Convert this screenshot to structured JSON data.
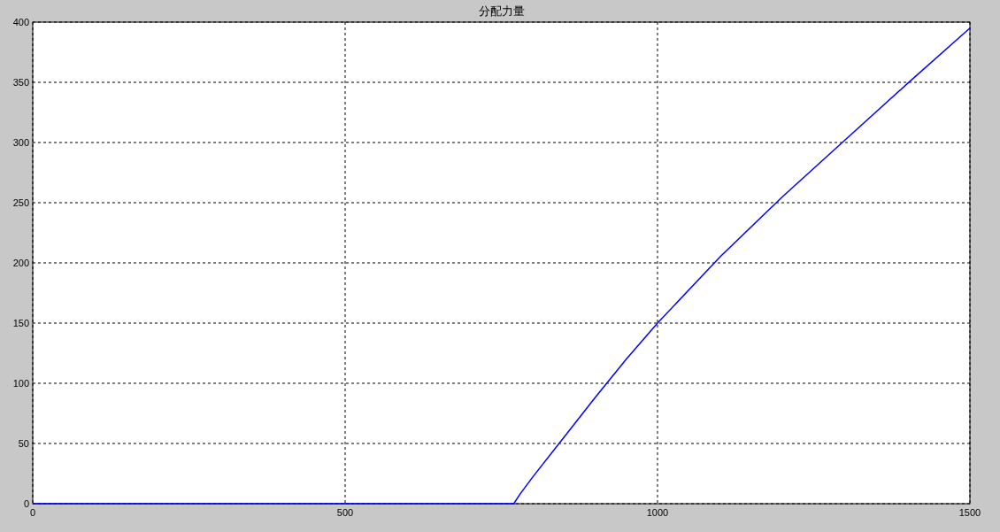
{
  "chart_data": {
    "type": "line",
    "title": "分配力量",
    "grid": true,
    "x": [
      0,
      770,
      780,
      800,
      850,
      900,
      950,
      1000,
      1100,
      1200,
      1300,
      1400,
      1500
    ],
    "series": [
      {
        "color": "#0000ff",
        "values": [
          0,
          0,
          8,
          22,
          55,
          88,
          120,
          150,
          205,
          255,
          302,
          349,
          395
        ]
      }
    ],
    "xlim": [
      0,
      1500
    ],
    "ylim": [
      0,
      400
    ],
    "xticks": [
      0,
      500,
      1000,
      1500
    ],
    "yticks": [
      0,
      50,
      100,
      150,
      200,
      250,
      300,
      350,
      400
    ]
  }
}
